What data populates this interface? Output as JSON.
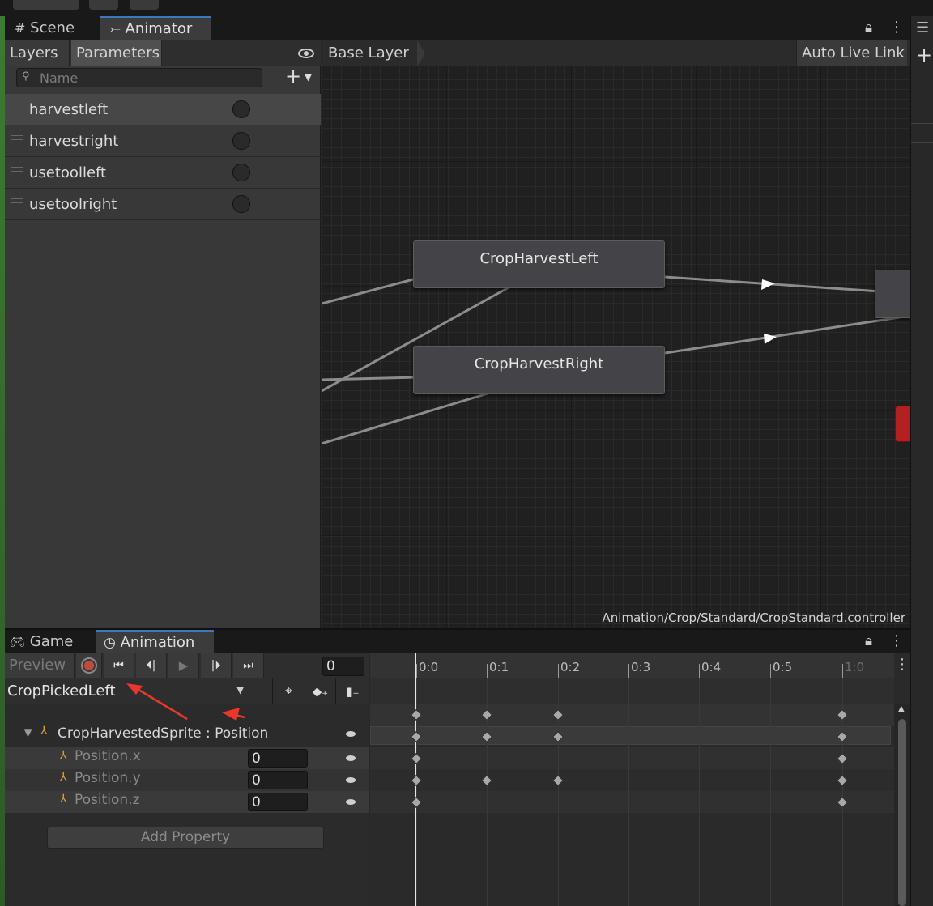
{
  "animator": {
    "tabs": [
      {
        "label": "Scene",
        "icon": "grid-icon"
      },
      {
        "label": "Animator",
        "icon": "animator-icon"
      }
    ],
    "subtabs": {
      "layers": "Layers",
      "parameters": "Parameters"
    },
    "search_placeholder": "Name",
    "parameters": [
      {
        "name": "harvestleft"
      },
      {
        "name": "harvestright"
      },
      {
        "name": "usetoolleft"
      },
      {
        "name": "usetoolright"
      }
    ],
    "breadcrumb": "Base Layer",
    "auto_live_link": "Auto Live Link",
    "states": [
      "CropHarvestLeft",
      "CropHarvestRight"
    ],
    "controller_path": "Animation/Crop/Standard/CropStandard.controller"
  },
  "animation": {
    "tabs": [
      {
        "label": "Game",
        "icon": "gamepad-icon"
      },
      {
        "label": "Animation",
        "icon": "clock-icon"
      }
    ],
    "preview": "Preview",
    "frame_value": "0",
    "clip_name": "CropPickedLeft",
    "ruler": [
      "0:0",
      "0:1",
      "0:2",
      "0:3",
      "0:4",
      "0:5",
      "1:0"
    ],
    "properties": {
      "group": "CropHarvestedSprite : Position",
      "items": [
        {
          "label": "Position.x",
          "value": "0"
        },
        {
          "label": "Position.y",
          "value": "0"
        },
        {
          "label": "Position.z",
          "value": "0"
        }
      ]
    },
    "add_property": "Add Property"
  },
  "colors": {
    "accent": "#3a79bb",
    "record": "#c24a3c",
    "annotation_arrow": "#e8382b",
    "exit_node": "#b22020"
  }
}
